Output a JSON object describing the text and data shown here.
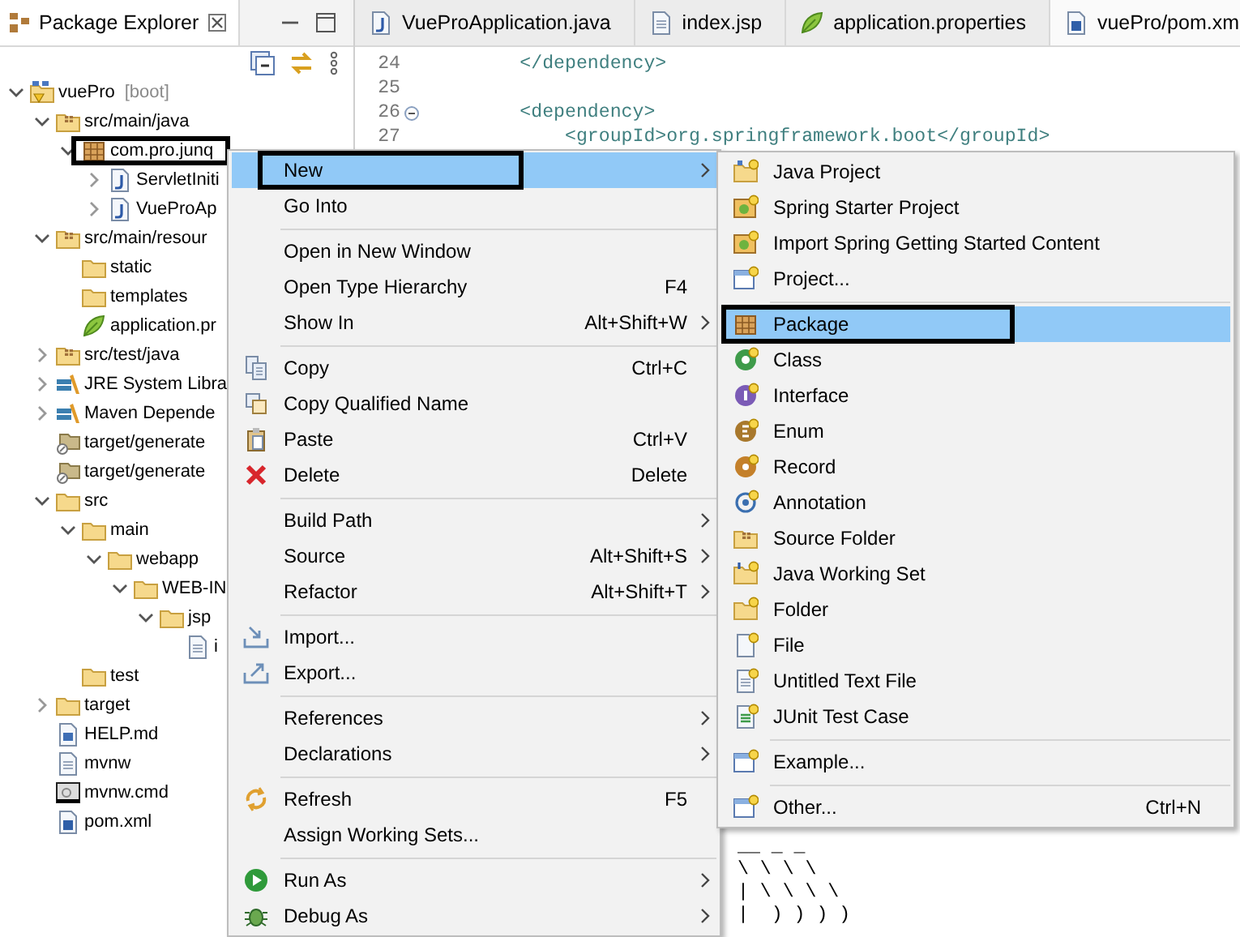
{
  "explorer": {
    "title": "Package Explorer",
    "tree": [
      {
        "label": "vuePro",
        "decoration": "[boot]",
        "kind": "project",
        "expanded": true,
        "children": [
          {
            "label": "src/main/java",
            "kind": "srcfolder",
            "expanded": true,
            "children": [
              {
                "label": "com.pro.junq",
                "kind": "package",
                "expanded": true,
                "annotated": true,
                "children": [
                  {
                    "label": "ServletIniti",
                    "kind": "java",
                    "expanded": false
                  },
                  {
                    "label": "VueProAp",
                    "kind": "java",
                    "expanded": false
                  }
                ]
              }
            ]
          },
          {
            "label": "src/main/resour",
            "kind": "srcfolder",
            "expanded": true,
            "children": [
              {
                "label": "static",
                "kind": "folder"
              },
              {
                "label": "templates",
                "kind": "folder"
              },
              {
                "label": "application.pr",
                "kind": "leaf"
              }
            ]
          },
          {
            "label": "src/test/java",
            "kind": "srcfolder",
            "expanded": false
          },
          {
            "label": "JRE System Libra",
            "kind": "library",
            "expanded": false
          },
          {
            "label": "Maven Depende",
            "kind": "library",
            "expanded": false
          },
          {
            "label": "target/generate",
            "kind": "genfolder"
          },
          {
            "label": "target/generate",
            "kind": "genfolder"
          },
          {
            "label": "src",
            "kind": "folder",
            "expanded": true,
            "children": [
              {
                "label": "main",
                "kind": "folder",
                "expanded": true,
                "children": [
                  {
                    "label": "webapp",
                    "kind": "folder",
                    "expanded": true,
                    "children": [
                      {
                        "label": "WEB-IN",
                        "kind": "folder",
                        "expanded": true,
                        "children": [
                          {
                            "label": "jsp",
                            "kind": "folder",
                            "expanded": true,
                            "children": [
                              {
                                "label": "i",
                                "kind": "doc"
                              }
                            ]
                          }
                        ]
                      }
                    ]
                  }
                ]
              },
              {
                "label": "test",
                "kind": "folder"
              }
            ]
          },
          {
            "label": "target",
            "kind": "folder",
            "expanded": false
          },
          {
            "label": "HELP.md",
            "kind": "word"
          },
          {
            "label": "mvnw",
            "kind": "doc"
          },
          {
            "label": "mvnw.cmd",
            "kind": "cmd"
          },
          {
            "label": "pom.xml",
            "kind": "maven"
          }
        ]
      }
    ]
  },
  "editor": {
    "tabs": [
      {
        "label": "VueProApplication.java",
        "kind": "java",
        "selected": false
      },
      {
        "label": "index.jsp",
        "kind": "doc",
        "selected": false
      },
      {
        "label": "application.properties",
        "kind": "leaf",
        "selected": false
      },
      {
        "label": "vuePro/pom.xm",
        "kind": "maven",
        "selected": true
      }
    ],
    "lines": [
      {
        "number": "24",
        "text": "        </dependency>",
        "collapsible": false
      },
      {
        "number": "25",
        "collapsible": false
      },
      {
        "number": "26",
        "text": "        <dependency>",
        "collapsible": true
      },
      {
        "number": "27",
        "text": "            <groupId>org.springframework.boot</groupId>",
        "collapsible": false
      }
    ]
  },
  "console": {
    "lines": [
      "__ _ _",
      "\\ \\ \\ \\",
      "| \\ \\ \\ \\",
      "|  ) ) ) )"
    ]
  },
  "context_menu": {
    "items": [
      {
        "kind": "plain",
        "label": "New",
        "submenu": true,
        "selected": true,
        "annotated": true
      },
      {
        "kind": "plain",
        "label": "Go Into",
        "submenu": false,
        "selected": false,
        "annotated": false
      },
      {
        "kind": "separator"
      },
      {
        "kind": "plain",
        "label": "Open in New Window",
        "submenu": false,
        "selected": false,
        "annotated": false
      },
      {
        "kind": "plain",
        "label": "Open Type Hierarchy",
        "shortcut": "F4",
        "submenu": false,
        "selected": false,
        "annotated": false
      },
      {
        "kind": "plain",
        "label": "Show In",
        "shortcut": "Alt+Shift+W",
        "submenu": true,
        "selected": false,
        "annotated": false
      },
      {
        "kind": "separator"
      },
      {
        "kind": "copy",
        "label": "Copy",
        "shortcut": "Ctrl+C",
        "submenu": false,
        "selected": false,
        "annotated": false
      },
      {
        "kind": "copyq",
        "label": "Copy Qualified Name",
        "submenu": false,
        "selected": false,
        "annotated": false
      },
      {
        "kind": "paste",
        "label": "Paste",
        "shortcut": "Ctrl+V",
        "submenu": false,
        "selected": false,
        "annotated": false
      },
      {
        "kind": "delete",
        "label": "Delete",
        "shortcut": "Delete",
        "submenu": false,
        "selected": false,
        "annotated": false
      },
      {
        "kind": "separator"
      },
      {
        "kind": "plain",
        "label": "Build Path",
        "submenu": true,
        "selected": false,
        "annotated": false
      },
      {
        "kind": "plain",
        "label": "Source",
        "shortcut": "Alt+Shift+S",
        "submenu": true,
        "selected": false,
        "annotated": false
      },
      {
        "kind": "plain",
        "label": "Refactor",
        "shortcut": "Alt+Shift+T",
        "submenu": true,
        "selected": false,
        "annotated": false
      },
      {
        "kind": "separator"
      },
      {
        "kind": "import",
        "label": "Import...",
        "submenu": false,
        "selected": false,
        "annotated": false
      },
      {
        "kind": "export",
        "label": "Export...",
        "submenu": false,
        "selected": false,
        "annotated": false
      },
      {
        "kind": "separator"
      },
      {
        "kind": "plain",
        "label": "References",
        "submenu": true,
        "selected": false,
        "annotated": false
      },
      {
        "kind": "plain",
        "label": "Declarations",
        "submenu": true,
        "selected": false,
        "annotated": false
      },
      {
        "kind": "separator"
      },
      {
        "kind": "refresh",
        "label": "Refresh",
        "shortcut": "F5",
        "submenu": false,
        "selected": false,
        "annotated": false
      },
      {
        "kind": "plain",
        "label": "Assign Working Sets...",
        "submenu": false,
        "selected": false,
        "annotated": false
      },
      {
        "kind": "separator"
      },
      {
        "kind": "run",
        "label": "Run As",
        "submenu": true,
        "selected": false,
        "annotated": false
      },
      {
        "kind": "debug",
        "label": "Debug As",
        "submenu": true,
        "selected": false,
        "annotated": false
      }
    ]
  },
  "new_submenu": {
    "items": [
      {
        "kind": "newproject",
        "label": "Java Project",
        "selected": false,
        "annotated": false
      },
      {
        "kind": "spring",
        "label": "Spring Starter Project",
        "selected": false,
        "annotated": false
      },
      {
        "kind": "spring",
        "label": "Import Spring Getting Started Content",
        "selected": false,
        "annotated": false
      },
      {
        "kind": "window",
        "label": "Project...",
        "selected": false,
        "annotated": false
      },
      {
        "kind": "separator"
      },
      {
        "kind": "package",
        "label": "Package",
        "selected": true,
        "annotated": true
      },
      {
        "kind": "class",
        "label": "Class",
        "selected": false,
        "annotated": false
      },
      {
        "kind": "interface",
        "label": "Interface",
        "selected": false,
        "annotated": false
      },
      {
        "kind": "enum",
        "label": "Enum",
        "selected": false,
        "annotated": false
      },
      {
        "kind": "record",
        "label": "Record",
        "selected": false,
        "annotated": false
      },
      {
        "kind": "annotation",
        "label": "Annotation",
        "selected": false,
        "annotated": false
      },
      {
        "kind": "srcfolder",
        "label": "Source Folder",
        "selected": false,
        "annotated": false
      },
      {
        "kind": "workingset",
        "label": "Java Working Set",
        "selected": false,
        "annotated": false
      },
      {
        "kind": "newfolder",
        "label": "Folder",
        "selected": false,
        "annotated": false
      },
      {
        "kind": "newfile",
        "label": "File",
        "selected": false,
        "annotated": false
      },
      {
        "kind": "textfile",
        "label": "Untitled Text File",
        "selected": false,
        "annotated": false
      },
      {
        "kind": "junit",
        "label": "JUnit Test Case",
        "selected": false,
        "annotated": false
      },
      {
        "kind": "separator"
      },
      {
        "kind": "window",
        "label": "Example...",
        "selected": false,
        "annotated": false
      },
      {
        "kind": "separator"
      },
      {
        "kind": "window",
        "label": "Other...",
        "shortcut": "Ctrl+N",
        "selected": false,
        "annotated": false
      }
    ]
  }
}
